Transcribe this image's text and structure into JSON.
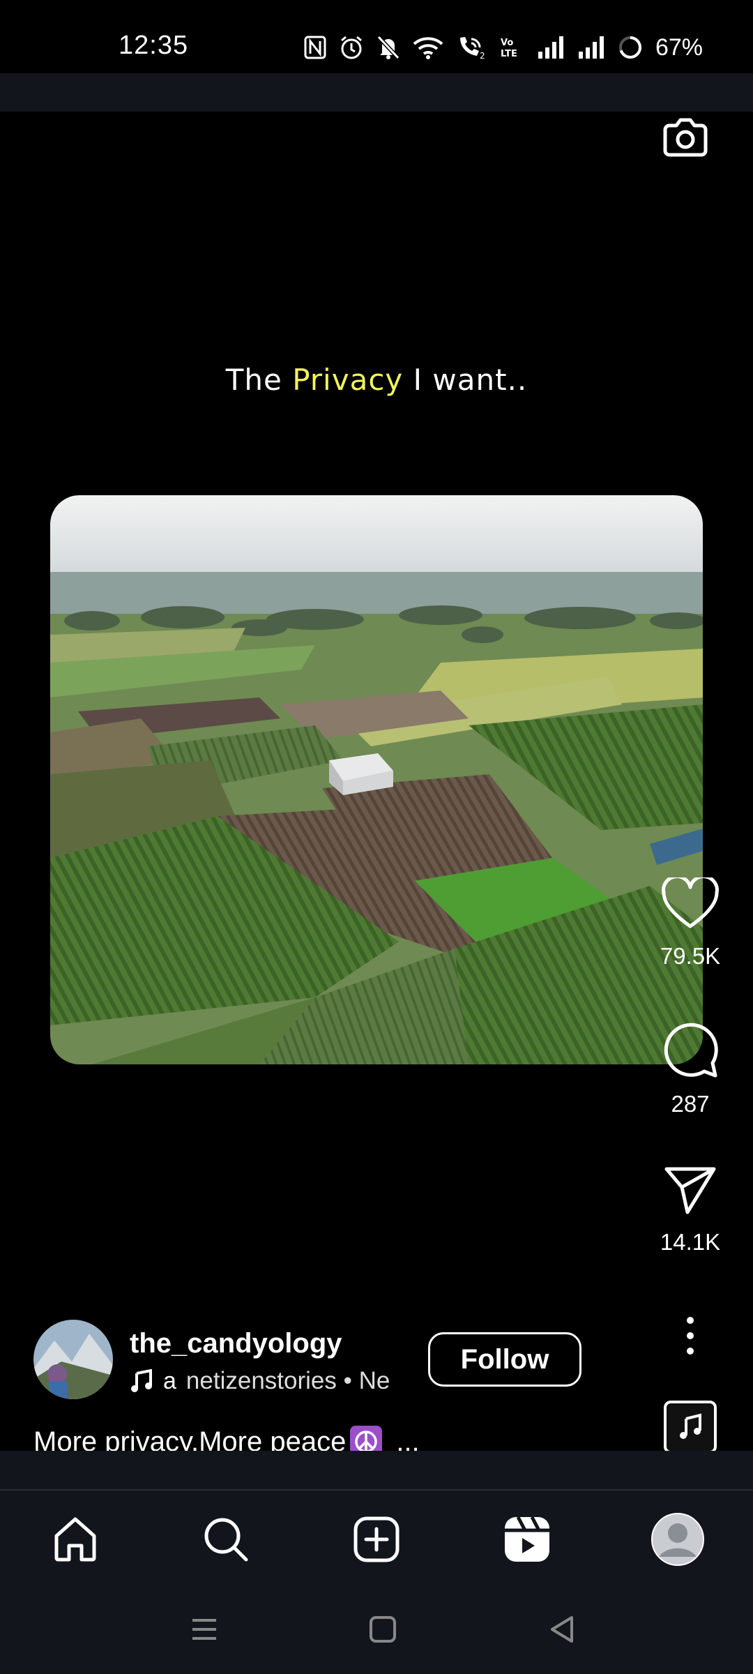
{
  "status_bar": {
    "time": "12:35",
    "battery": "67%",
    "icons": [
      "nfc-icon",
      "alarm-icon",
      "bell-muted-icon",
      "wifi-icon",
      "wifi-call-icon",
      "volte-icon",
      "signal-icon",
      "signal-icon",
      "battery-ring-icon"
    ],
    "volte_label": "Vo LTE"
  },
  "reel": {
    "caption_prefix": "The ",
    "caption_highlight": "Privacy",
    "caption_suffix": " I want..",
    "highlight_color": "#f4f55a"
  },
  "actions": {
    "likes": "79.5K",
    "comments": "287",
    "shares": "14.1K"
  },
  "author": {
    "username": "the_candyology",
    "audio_glyph": "a",
    "audio_text": "netizenstories • Ne",
    "follow_label": "Follow"
  },
  "post": {
    "caption": "More privacy.More peace",
    "ellipsis": "..."
  },
  "nav": {
    "items": [
      "home-icon",
      "search-icon",
      "create-icon",
      "reels-icon",
      "profile-icon"
    ]
  },
  "colors": {
    "background": "#000000",
    "nav_background": "#12161c",
    "peace_bg": "#9b4fc8"
  }
}
